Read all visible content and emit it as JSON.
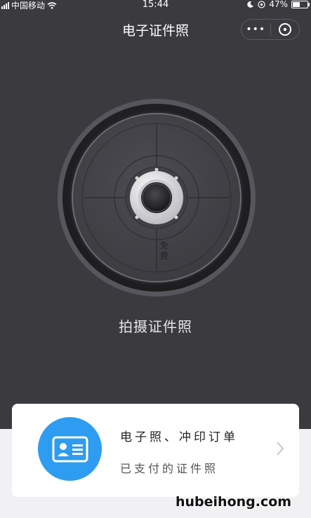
{
  "status": {
    "carrier": "中国移动",
    "time": "15:44",
    "battery": "47%",
    "battery_level": 0.47
  },
  "nav": {
    "title": "电子证件照",
    "more_glyph": "•••"
  },
  "camera": {
    "free_label_line1": "免",
    "free_label_line2": "费"
  },
  "capture_label": "拍摄证件照",
  "card": {
    "title": "电子照、冲印订单",
    "subtitle": "已支付的证件照"
  },
  "watermark": "hubeihong.com",
  "colors": {
    "background": "#3a3a3f",
    "accent": "#2e9cf0",
    "card": "#ffffff"
  }
}
